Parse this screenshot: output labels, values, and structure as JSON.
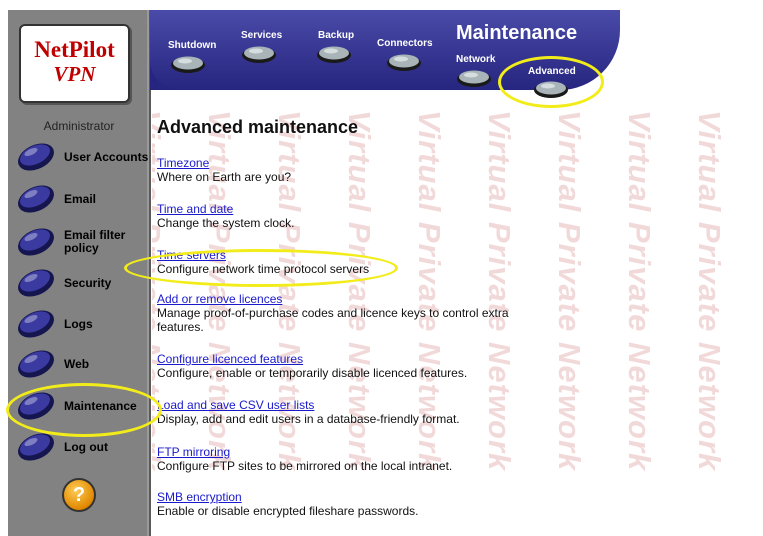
{
  "logo": {
    "line1": "NetPilot",
    "line2": "VPN"
  },
  "sidebar": {
    "role": "Administrator",
    "items": [
      {
        "label": "User Accounts",
        "icon": "user-accounts-icon"
      },
      {
        "label": "Email",
        "icon": "email-icon"
      },
      {
        "label": "Email filter policy",
        "icon": "email-filter-icon"
      },
      {
        "label": "Security",
        "icon": "security-icon"
      },
      {
        "label": "Logs",
        "icon": "logs-icon"
      },
      {
        "label": "Web",
        "icon": "web-icon"
      },
      {
        "label": "Maintenance",
        "icon": "maintenance-icon"
      },
      {
        "label": "Log out",
        "icon": "logout-icon"
      }
    ],
    "help": "?"
  },
  "topnav": {
    "title": "Maintenance",
    "tabs": [
      {
        "label": "Shutdown"
      },
      {
        "label": "Services"
      },
      {
        "label": "Backup"
      },
      {
        "label": "Connectors"
      },
      {
        "label": "Network"
      },
      {
        "label": "Advanced"
      }
    ]
  },
  "main": {
    "heading": "Advanced maintenance",
    "watermark": "Virtual Private Network",
    "entries": [
      {
        "link": "Timezone",
        "desc": "Where on Earth are you?"
      },
      {
        "link": "Time and date",
        "desc": "Change the system clock."
      },
      {
        "link": "Time servers",
        "desc": "Configure network time protocol servers"
      },
      {
        "link": "Add or remove licences",
        "desc": "Manage proof-of-purchase codes and licence keys to control extra features."
      },
      {
        "link": "Configure licenced features",
        "desc": "Configure, enable or temporarily disable licenced features."
      },
      {
        "link": "Load and save CSV user lists",
        "desc": "Display, add and edit users in a database-friendly format."
      },
      {
        "link": "FTP mirroring",
        "desc": "Configure FTP sites to be mirrored on the local intranet."
      },
      {
        "link": "SMB encryption",
        "desc": "Enable or disable encrypted fileshare passwords."
      }
    ]
  },
  "colors": {
    "sidebar": "#828282",
    "topbar": "#2e2e8c",
    "link": "#1a1acc",
    "highlight": "#f2ec1a",
    "watermark": "#f0d0d0"
  }
}
